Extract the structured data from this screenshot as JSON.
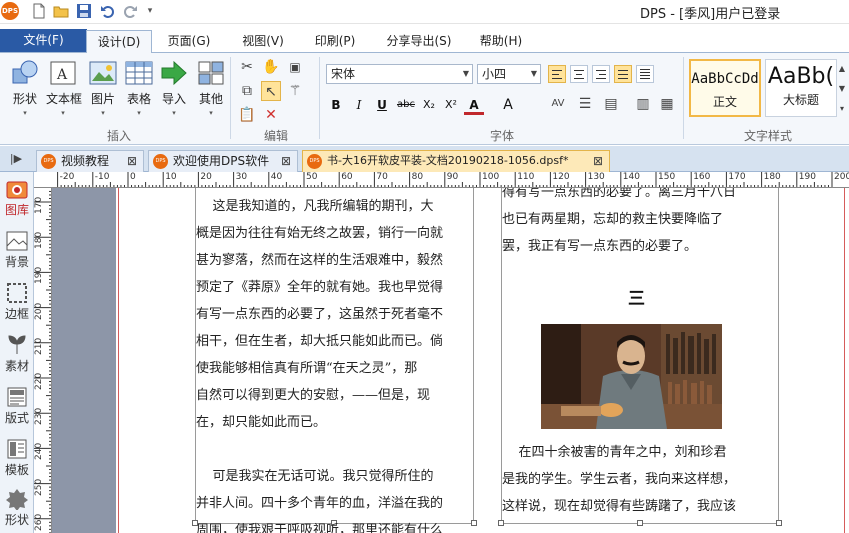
{
  "app": {
    "logo_text": "DPS",
    "window_title": "DPS - [季风]用户已登录"
  },
  "quick_access": [
    "new-icon",
    "open-icon",
    "save-icon",
    "undo-icon",
    "redo-icon",
    "customize-icon"
  ],
  "menu": {
    "file": "文件(F)",
    "tabs": [
      "设计(D)",
      "页面(G)",
      "视图(V)",
      "印刷(P)",
      "分享导出(S)",
      "帮助(H)"
    ],
    "active_index": 0
  },
  "ribbon": {
    "insert": {
      "group_label": "插入",
      "buttons": [
        "形状",
        "文本框",
        "图片",
        "表格",
        "导入",
        "其他"
      ]
    },
    "edit": {
      "group_label": "编辑"
    },
    "font": {
      "group_label": "字体",
      "font_name": "宋体",
      "font_size": "小四",
      "format_buttons": [
        "B",
        "I",
        "U",
        "abc",
        "X₂",
        "X²",
        "A",
        "A"
      ]
    },
    "text_style": {
      "group_label": "文字样式",
      "styles": [
        {
          "sample": "AaBbCcDd",
          "name": "正文"
        },
        {
          "sample": "AaBb(",
          "name": "大标题"
        }
      ]
    }
  },
  "doc_tabs": [
    {
      "label": "视频教程",
      "active": false
    },
    {
      "label": "欢迎使用DPS软件",
      "active": false
    },
    {
      "label": "书-大16开软皮平装-文档20190218-1056.dpsf*",
      "active": true
    }
  ],
  "left_panel": [
    {
      "label": "图库",
      "icon": "gallery-icon",
      "active": true
    },
    {
      "label": "背景",
      "icon": "background-icon",
      "active": false
    },
    {
      "label": "边框",
      "icon": "border-icon",
      "active": false
    },
    {
      "label": "素材",
      "icon": "material-icon",
      "active": false
    },
    {
      "label": "版式",
      "icon": "layout-icon",
      "active": false
    },
    {
      "label": "模板",
      "icon": "template-icon",
      "active": false
    },
    {
      "label": "形状",
      "icon": "shape-icon",
      "active": false
    }
  ],
  "rulers": {
    "horizontal": [
      "-20",
      "-10",
      "0",
      "10",
      "20",
      "30",
      "40",
      "50",
      "60",
      "70",
      "80",
      "90",
      "100",
      "110",
      "120",
      "130",
      "140",
      "150",
      "160",
      "170",
      "180",
      "190",
      "200"
    ],
    "vertical": [
      "170",
      "180",
      "190",
      "200",
      "210",
      "220",
      "230",
      "240",
      "250",
      "260"
    ]
  },
  "document": {
    "left_column": [
      "    这是我知道的，凡我所编辑的期刊，大",
      "概是因为往往有始无终之故罢，销行一向就",
      "甚为寥落，然而在这样的生活艰难中，毅然",
      "预定了《莽原》全年的就有她。我也早觉得",
      "有写一点东西的必要了，这虽然于死者毫不",
      "相干，但在生者，却大抵只能如此而已。倘",
      "使我能够相信真有所谓“在天之灵”，那",
      "自然可以得到更大的安慰，——但是，现",
      "在，却只能如此而已。",
      "",
      "    可是我实在无话可说。我只觉得所住的",
      "并非人间。四十多个青年的血，洋溢在我的",
      "周围，使我艰于呼吸视听，那里还能有什么"
    ],
    "right_column_top": [
      "得有写一点东西的必要了。离三月十八日",
      "也已有两星期，忘却的救主快要降临了",
      "罢，我正有写一点东西的必要了。"
    ],
    "chapter": "三",
    "right_column_bottom": [
      "    在四十余被害的青年之中，刘和珍君",
      "是我的学生。学生云者，我向来这样想，",
      "这样说，现在却觉得有些踌躇了，我应该"
    ]
  }
}
